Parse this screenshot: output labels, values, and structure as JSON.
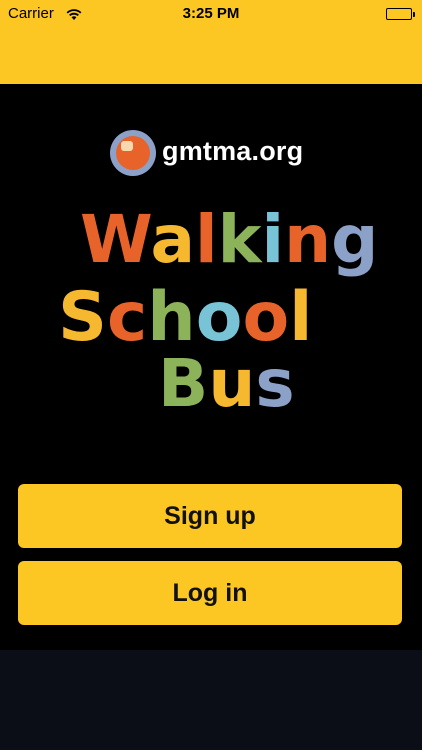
{
  "status_bar": {
    "carrier": "Carrier",
    "time": "3:25 PM",
    "icons": [
      "wifi-icon",
      "battery-icon"
    ]
  },
  "brand": {
    "logo_text": "gmtma.org",
    "title_lines": [
      "Walking",
      "School",
      "Bus"
    ]
  },
  "actions": {
    "signup_label": "Sign up",
    "login_label": "Log in"
  },
  "colors": {
    "accent": "#fcc723",
    "background": "#000000",
    "footer": "#0b0e16",
    "title_orange": "#e8632a",
    "title_yellow": "#f5b82e",
    "title_blue": "#79c3d6",
    "title_green": "#8db35a",
    "title_slate": "#8ca1c8"
  }
}
